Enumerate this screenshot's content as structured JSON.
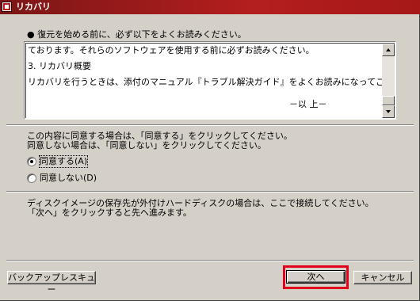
{
  "window": {
    "title": "リカバリ"
  },
  "intro": "● 復元を始める前に、必ず以下をよくお読みください。",
  "license": {
    "lines": [
      "ております。それらのソフトウェアを使用する前に必ずお読みください。",
      "3. リカバリ概要",
      "リカバリを行うときは、添付のマニュアル『トラブル解決ガイド』をよくお読みになってご使用ください。"
    ],
    "end_mark": "－以 上－"
  },
  "agree": {
    "line1": "この内容に同意する場合は、「同意する」をクリックしてください。",
    "line2": "同意しない場合は、「同意しない」をクリックしてください。"
  },
  "radios": [
    {
      "label": "同意する(A)",
      "checked": true
    },
    {
      "label": "同意しない(D)",
      "checked": false
    }
  ],
  "note": {
    "line1": "ディスクイメージの保存先が外付けハードディスクの場合は、ここで接続してください。",
    "line2": "「次へ」をクリックすると先へ進みます。"
  },
  "buttons": {
    "backup_rescue": "バックアップレスキュー",
    "next": "次へ",
    "cancel": "キャンセル"
  },
  "colors": {
    "title_bar": "#a61818",
    "highlight": "#e3001b",
    "dialog_bg": "#d4d0c8"
  },
  "icons": {
    "app": "recovery-app-icon",
    "scroll_up": "arrow-up-icon",
    "scroll_down": "arrow-down-icon"
  }
}
